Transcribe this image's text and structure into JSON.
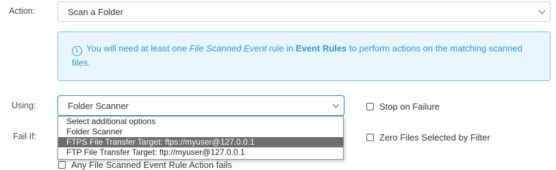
{
  "action": {
    "label": "Action:",
    "selected": "Scan a Folder"
  },
  "info_box": {
    "icon": "info-circle-icon",
    "text_1": "You will need at least one ",
    "italic_1": "File Scanned Event",
    "text_2": " rule in ",
    "bold_1": "Event Rules",
    "text_3": " to perform actions on the matching scanned files."
  },
  "using": {
    "label": "Using:",
    "selected": "Folder Scanner",
    "options": [
      "Select additional options",
      "Folder Scanner",
      "FTPS File Transfer Target: ftps://myuser@127.0.0.1",
      "FTP File Transfer Target: ftp://myuser@127.0.0.1"
    ],
    "highlighted_index": 2
  },
  "stop_on_failure": {
    "label": "Stop on Failure",
    "checked": false
  },
  "fail_if": {
    "label": "Fail If:",
    "zero_files_label": "Zero Files Selected by Filter",
    "zero_files_checked": false
  },
  "partial_checkbox": {
    "label": "Any File Scanned Event Rule Action fails"
  },
  "colors": {
    "info_text": "#2a9bc9",
    "info_bg": "#e8f6fc",
    "info_border": "#6cc3de",
    "focus_border": "#2e8bd0",
    "highlight_bg": "#6e6e6e"
  }
}
